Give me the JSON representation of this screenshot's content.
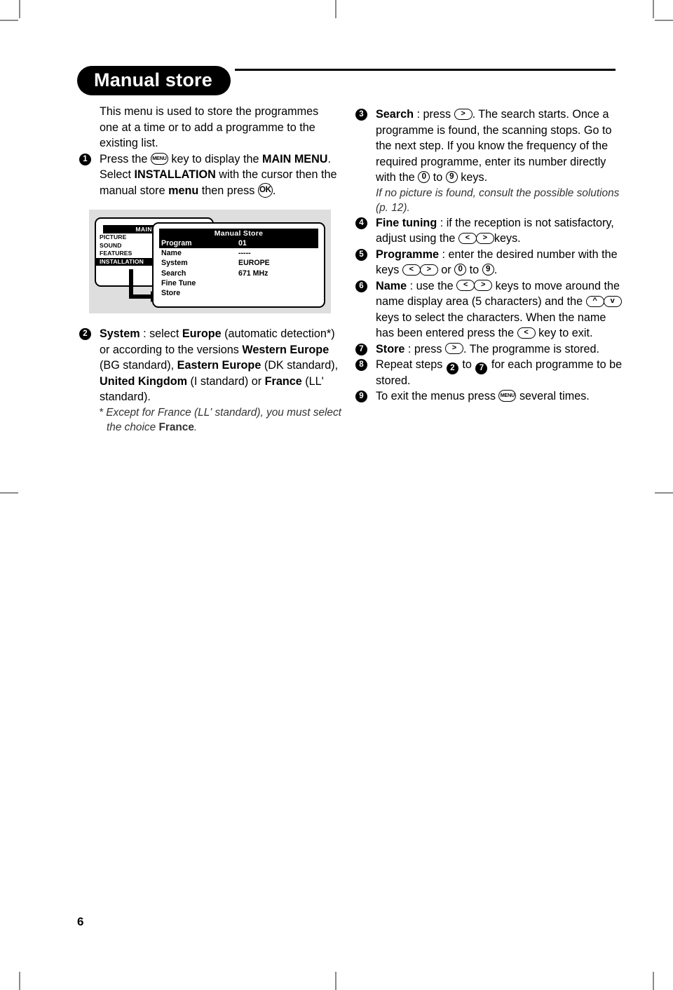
{
  "page": {
    "number": "6",
    "title": "Manual store"
  },
  "left_column": {
    "intro": "This menu is used to store the programmes one at a time or to add a programme to the existing list.",
    "step1": {
      "num": "1",
      "t1": "Press the ",
      "key1": "MENU",
      "t2": " key to display the ",
      "b1": "MAIN MENU",
      "t3": ". Select ",
      "b2": "INSTALLATION",
      "t4": " with the cursor then the manual store ",
      "b3": "menu",
      "t5": " then press ",
      "key2": "OK",
      "t6": "."
    },
    "step2": {
      "num": "2",
      "b1": "System",
      "t1": " : select ",
      "b2": "Europe",
      "t2": " (automatic detection*) or according to the versions ",
      "b3": "Western Europe",
      "t3": " (BG standard), ",
      "b4": "Eastern Europe",
      "t4": " (DK standard), ",
      "b5": "United Kingdom",
      "t5": " (I standard) or ",
      "b6": "France",
      "t6": " (LL' standard).",
      "footnote_pre": "* Except for France (LL' standard), you must select the choice ",
      "footnote_bold": "France",
      "footnote_post": "."
    }
  },
  "right_column": {
    "step3": {
      "num": "3",
      "b1": "Search",
      "t1": " : press ",
      "key1": ">",
      "t2": ". The search starts. Once a programme is found, the scanning stops. Go to the next step. If you know the frequency of the required programme, enter its number directly with the ",
      "key2": "0",
      "t3": " to ",
      "key3": "9",
      "t4": " keys.",
      "note": "If no picture is found, consult the possible solutions (p. 12)."
    },
    "step4": {
      "num": "4",
      "b1": "Fine tuning",
      "t1": " : if the reception is not satisfactory, adjust using the ",
      "key1": "<",
      "key2": ">",
      "t2": "keys."
    },
    "step5": {
      "num": "5",
      "b1": "Programme",
      "t1": " : enter the desired number with the keys ",
      "key1": "<",
      "key2": ">",
      "t2": " or ",
      "key3": "0",
      "t3": " to ",
      "key4": "9",
      "t4": "."
    },
    "step6": {
      "num": "6",
      "b1": "Name",
      "t1": " : use the ",
      "key1": "<",
      "key2": ">",
      "t2": " keys to move around the name display area (5 characters) and the ",
      "key3": "^",
      "key4": "v",
      "t3": " keys to select the characters. When the name has been entered press the ",
      "key5": "<",
      "t4": " key to exit."
    },
    "step7": {
      "num": "7",
      "b1": "Store",
      "t1": " : press ",
      "key1": ">",
      "t2": ". The programme is stored."
    },
    "step8": {
      "num": "8",
      "t1": "Repeat steps ",
      "ref1": "2",
      "t2": " to ",
      "ref2": "7",
      "t3": " for each programme to be stored."
    },
    "step9": {
      "num": "9",
      "t1": "To exit the menus press ",
      "key1": "MENU",
      "t2": " several times."
    }
  },
  "figure": {
    "main_menu": {
      "title": "MAIN MENU",
      "items": [
        {
          "label": "PICTURE",
          "selected": false
        },
        {
          "label": "SOUND",
          "selected": false
        },
        {
          "label": "FEATURES",
          "selected": false
        },
        {
          "label": "INSTALLATION",
          "selected": true
        }
      ]
    },
    "manual_store": {
      "title": "Manual Store",
      "rows": [
        {
          "label": "Program",
          "value": "01",
          "selected": true
        },
        {
          "label": "Name",
          "value": "-----",
          "selected": false
        },
        {
          "label": "System",
          "value": "EUROPE",
          "selected": false
        },
        {
          "label": "Search",
          "value": "671 MHz",
          "selected": false
        },
        {
          "label": "Fine Tune",
          "value": "",
          "selected": false
        },
        {
          "label": "Store",
          "value": "",
          "selected": false
        }
      ]
    }
  }
}
